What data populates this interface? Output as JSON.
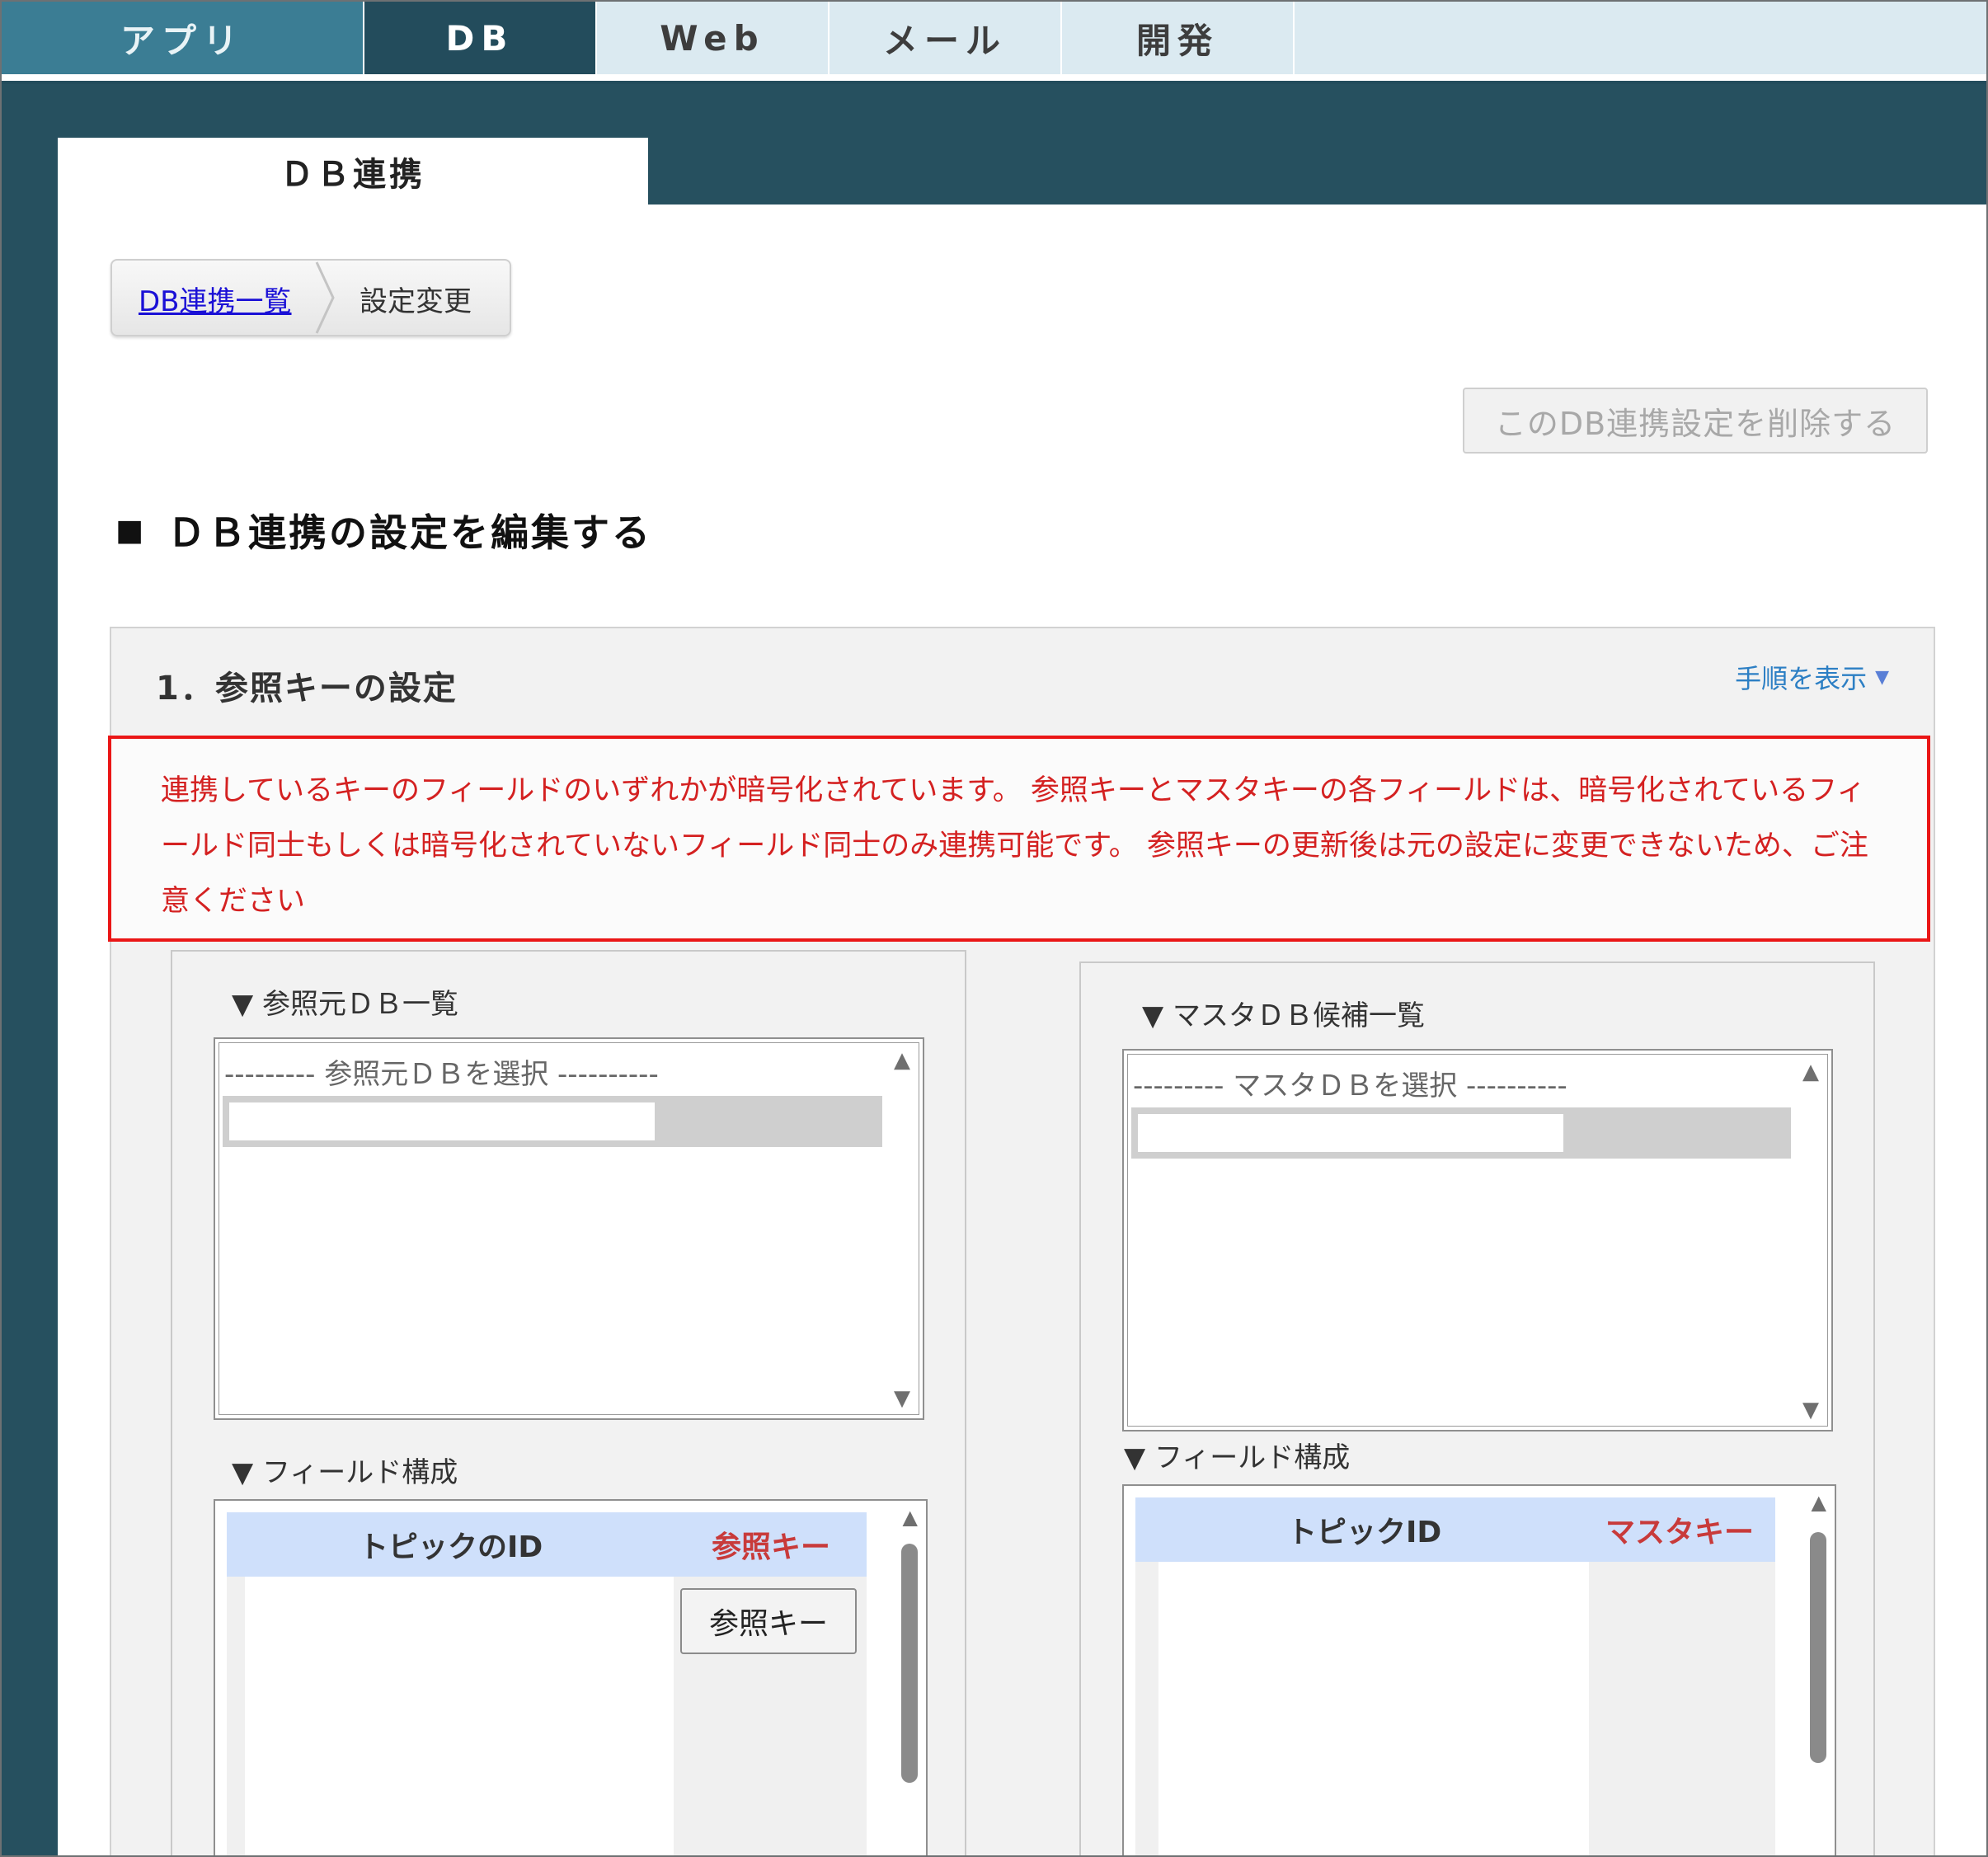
{
  "topnav": {
    "tabs": [
      {
        "label": "アプリ"
      },
      {
        "label": "DB"
      },
      {
        "label": "Web"
      },
      {
        "label": "メール"
      },
      {
        "label": "開発"
      }
    ]
  },
  "section_tab": "ＤＢ連携",
  "breadcrumb": {
    "link": "DB連携一覧",
    "current": "設定変更"
  },
  "delete_button": "このDB連携設定を削除する",
  "heading": {
    "marker": "■",
    "text": "ＤＢ連携の設定を編集する"
  },
  "step": {
    "title": "1．参照キーの設定",
    "toggle_link": "手順を表示",
    "warning": "連携しているキーのフィールドのいずれかが暗号化されています。 参照キーとマスタキーの各フィールドは、暗号化されているフィールド同士もしくは暗号化されていないフィールド同士のみ連携可能です。 参照キーの更新後は元の設定に変更できないため、ご注意ください"
  },
  "left_panel": {
    "db_list_title": "▼ 参照元ＤＢ一覧",
    "db_placeholder": "--------- 参照元ＤＢを選択 ----------",
    "field_title": "▼ フィールド構成",
    "field_header": "トピックのID",
    "key_header": "参照キー",
    "key_button": "参照キー"
  },
  "right_panel": {
    "db_list_title": "▼ マスタＤＢ候補一覧",
    "db_placeholder": "--------- マスタＤＢを選択 ----------",
    "field_title": "▼ フィールド構成",
    "field_header": "トピックID",
    "key_header": "マスタキー"
  },
  "colors": {
    "nav_dark": "#234c5c",
    "nav_app": "#3b7d94",
    "warning_red": "#ea1616",
    "key_red": "#c83a3a",
    "link_blue": "#2c7fc4"
  }
}
